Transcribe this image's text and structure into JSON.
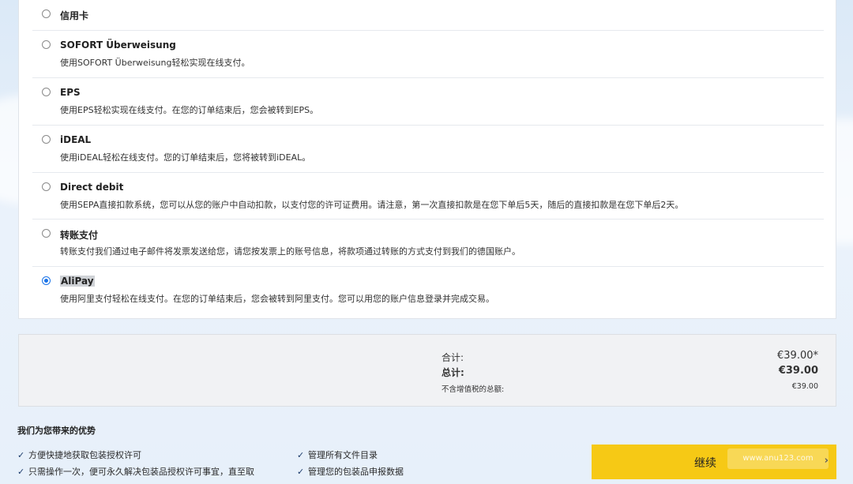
{
  "payment_options": [
    {
      "title": "信用卡",
      "desc": "",
      "selected": false
    },
    {
      "title": "SOFORT Überweisung",
      "desc": "使用SOFORT Überweisung轻松实现在线支付。",
      "selected": false
    },
    {
      "title": "EPS",
      "desc": "使用EPS轻松实现在线支付。在您的订单结束后，您会被转到EPS。",
      "selected": false
    },
    {
      "title": "iDEAL",
      "desc": "使用iDEAL轻松在线支付。您的订单结束后，您将被转到iDEAL。",
      "selected": false
    },
    {
      "title": "Direct debit",
      "desc": "使用SEPA直接扣款系统，您可以从您的账户中自动扣款，以支付您的许可证费用。请注意，第一次直接扣款是在您下单后5天，随后的直接扣款是在您下单后2天。",
      "selected": false
    },
    {
      "title": "转账支付",
      "desc": "转账支付我们通过电子邮件将发票发送给您，请您按发票上的账号信息，将款项通过转账的方式支付到我们的德国账户。",
      "selected": false
    },
    {
      "title": "AliPay",
      "desc": "使用阿里支付轻松在线支付。在您的订单结束后，您会被转到阿里支付。您可以用您的账户信息登录并完成交易。",
      "selected": true
    }
  ],
  "summary": {
    "subtotal_label": "合计:",
    "subtotal_value": "€39.00*",
    "total_label": "总计:",
    "total_value": "€39.00",
    "net_label": "不含增值税的总额:",
    "net_value": "€39.00"
  },
  "advantages": {
    "title": "我们为您带来的优势",
    "items": [
      "方便快捷地获取包装授权许可",
      "只需操作一次，便可永久解决包装品授权许可事宜，直至取",
      "管理所有文件目录",
      "管理您的包装品申报数据"
    ]
  },
  "continue_button": {
    "label": "继续",
    "icon": "chevron-right-icon"
  },
  "watermark": "www.anu123.com",
  "colors": {
    "accent": "#f6c915",
    "radio_selected": "#1a73e8"
  }
}
